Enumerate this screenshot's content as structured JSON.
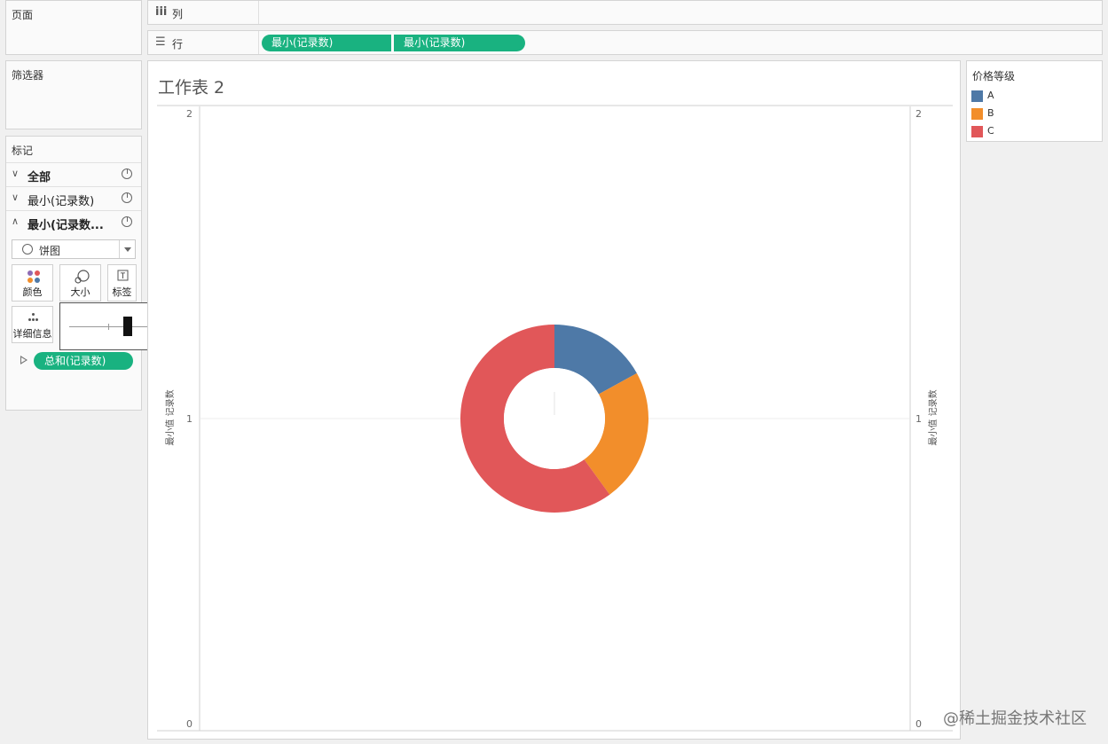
{
  "left_panel": {
    "pages_title": "页面",
    "filters_title": "筛选器",
    "marks_title": "标记",
    "mark_rows": [
      {
        "label": "全部",
        "expanded": false
      },
      {
        "label": "最小(记录数)",
        "expanded": false
      },
      {
        "label": "最小(记录数...",
        "expanded": true
      }
    ],
    "mark_type": "饼图",
    "buttons": {
      "color": "颜色",
      "size": "大小",
      "label": "标签",
      "detail": "详细信息"
    },
    "label_field_pill": "总和(记录数)",
    "size_popup_level": 0.37
  },
  "shelves": {
    "columns_label": "列",
    "rows_label": "行",
    "row_pills": [
      "最小(记录数)",
      "最小(记录数)"
    ]
  },
  "view": {
    "title": "工作表 2",
    "y_axis_title_left": "最小值 记录数",
    "y_axis_title_right": "最小值 记录数"
  },
  "legend": {
    "title": "价格等级",
    "items": [
      {
        "label": "A",
        "color": "#4e79a7"
      },
      {
        "label": "B",
        "color": "#f28e2b"
      },
      {
        "label": "C",
        "color": "#e15759"
      }
    ]
  },
  "chart_data": {
    "type": "pie",
    "style": "donut",
    "categories": [
      "A",
      "B",
      "C"
    ],
    "values": [
      0.17,
      0.23,
      0.6
    ],
    "colors": [
      "#4e79a7",
      "#f28e2b",
      "#e15759"
    ],
    "y_axis": {
      "ticks": [
        0,
        1,
        2
      ],
      "ylim": [
        0,
        2
      ]
    },
    "center_value": 1,
    "grid": true
  },
  "watermark": "@稀土掘金技术社区"
}
